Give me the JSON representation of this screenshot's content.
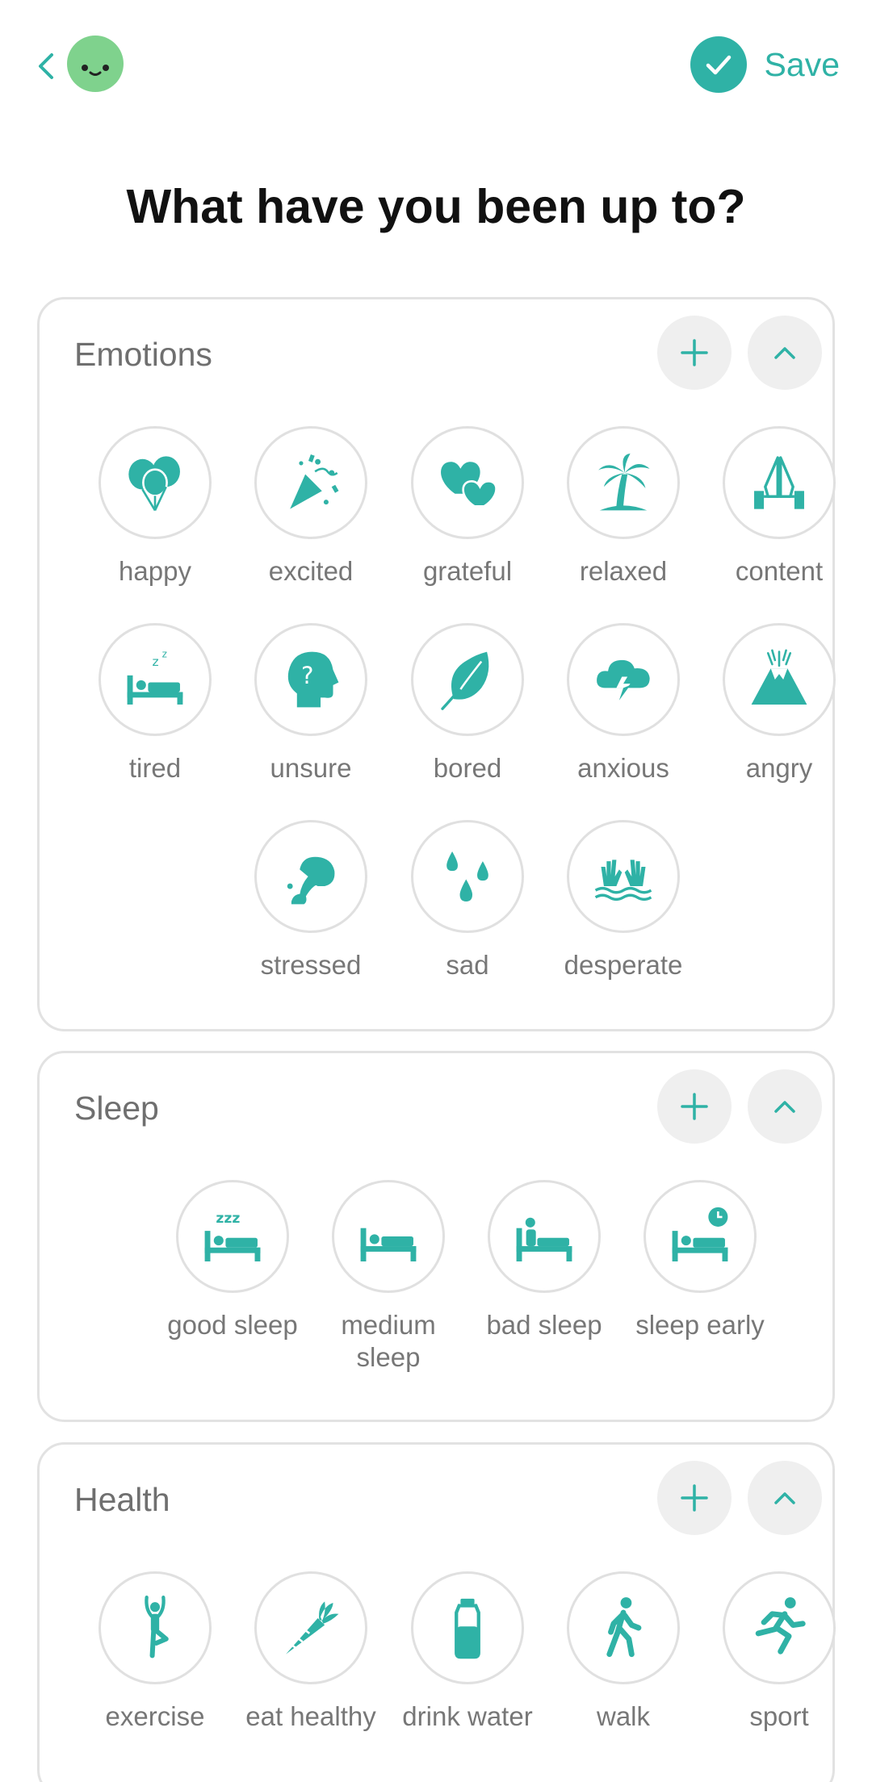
{
  "header": {
    "back_icon": "chevron-left-icon",
    "avatar": "smiley-face",
    "save_label": "Save"
  },
  "title": "What have you been up to?",
  "accent_color": "#2fb2a6",
  "avatar_color": "#7fd28d",
  "sections": {
    "emotions": {
      "title": "Emotions",
      "items": [
        {
          "label": "happy",
          "icon": "balloons-icon"
        },
        {
          "label": "excited",
          "icon": "party-popper-icon"
        },
        {
          "label": "grateful",
          "icon": "hearts-icon"
        },
        {
          "label": "relaxed",
          "icon": "palm-tree-icon"
        },
        {
          "label": "content",
          "icon": "praying-hands-icon"
        },
        {
          "label": "tired",
          "icon": "sleeping-bed-icon"
        },
        {
          "label": "unsure",
          "icon": "question-head-icon"
        },
        {
          "label": "bored",
          "icon": "leaf-icon"
        },
        {
          "label": "anxious",
          "icon": "storm-cloud-icon"
        },
        {
          "label": "angry",
          "icon": "volcano-icon"
        },
        {
          "label": "stressed",
          "icon": "squeezing-hand-icon"
        },
        {
          "label": "sad",
          "icon": "tear-drops-icon"
        },
        {
          "label": "desperate",
          "icon": "drowning-hands-icon"
        }
      ]
    },
    "sleep": {
      "title": "Sleep",
      "items": [
        {
          "label": "good sleep",
          "icon": "bed-zzz-icon"
        },
        {
          "label": "medium sleep",
          "icon": "bed-icon"
        },
        {
          "label": "bad sleep",
          "icon": "bed-awake-icon"
        },
        {
          "label": "sleep early",
          "icon": "bed-clock-icon"
        }
      ]
    },
    "health": {
      "title": "Health",
      "items": [
        {
          "label": "exercise",
          "icon": "yoga-icon"
        },
        {
          "label": "eat healthy",
          "icon": "carrot-icon"
        },
        {
          "label": "drink water",
          "icon": "water-bottle-icon"
        },
        {
          "label": "walk",
          "icon": "walking-icon"
        },
        {
          "label": "sport",
          "icon": "running-icon"
        }
      ]
    }
  }
}
